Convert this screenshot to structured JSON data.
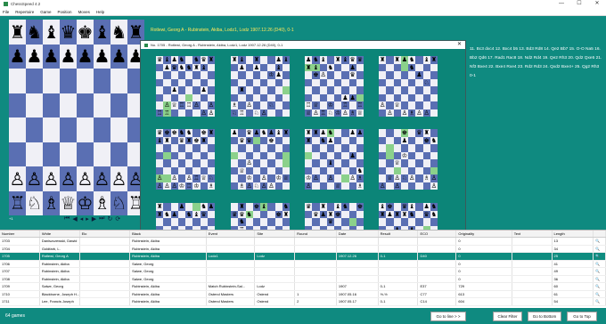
{
  "window": {
    "title": "ChessSpeed 4.2",
    "controls": [
      "—",
      "☐",
      "✕"
    ]
  },
  "menu": [
    "File",
    "Repertoire",
    "Game",
    "Position",
    "Moves",
    "Help"
  ],
  "main_board": {
    "ranks": [
      [
        "♜",
        "♞",
        "♝",
        "♛",
        "♚",
        "♝",
        "♞",
        "♜"
      ],
      [
        "♟",
        "♟",
        "♟",
        "♟",
        "♟",
        "♟",
        "♟",
        "♟"
      ],
      [
        "",
        "",
        "",
        "",
        "",
        "",
        "",
        ""
      ],
      [
        "",
        "",
        "",
        "",
        "",
        "",
        "",
        ""
      ],
      [
        "",
        "",
        "",
        "",
        "",
        "",
        "",
        ""
      ],
      [
        "",
        "",
        "",
        "",
        "",
        "",
        "",
        ""
      ],
      [
        "♙",
        "♙",
        "♙",
        "♙",
        "♙",
        "♙",
        "♙",
        "♙"
      ],
      [
        "♖",
        "♘",
        "♗",
        "♕",
        "♔",
        "♗",
        "♘",
        "♖"
      ]
    ],
    "coordinate_label": "+1",
    "nav_icons": [
      "first-move-icon",
      "prev-move-icon",
      "prev-step-icon",
      "next-step-icon",
      "next-move-icon",
      "last-move-icon",
      "flip-icon"
    ],
    "nav_glyphs": [
      "⏮",
      "◀",
      "◂",
      "▸",
      "▶",
      "⏭",
      "↻",
      "⟳"
    ]
  },
  "game_header": "Rotlewi, Georg A - Rubinstein, Akiba, Lodz1, Lodz 1907.12.26 (D40), 0-1",
  "movetext": "11. Bc3 dxc4 12. Bxc4 b5 13. Bd3 Rd8 14. Qe2 Bb7 15. O-O Na5 16. Bb2 Qd6 17. Rad1 Rac8 18. Nd2 Rd4 19. Qe2 Rh3 20. Qd2 Qxe5 21. Nf3 Bxe4 22. Bxe4 Rxe4 23. Rd2 Rd3 24. Qxd2 Bxe4+ 25. Qg2 Rh3 0-1",
  "popup": {
    "title": "No. 1705 - Rotlewi, Georg A - Rubinstein, Akiba, Lodz1, Lodz 1907.12.26 (D40), 0-1",
    "close_glyph": "✕",
    "side_controls": [
      "○",
      "◆",
      "⮕"
    ]
  },
  "table": {
    "columns": [
      "Number",
      "White",
      "Elo",
      "Black",
      "Elo",
      "Event",
      "Site",
      "Round",
      "Date",
      "Result",
      "ECO",
      "Originality",
      "Text",
      "Length",
      ""
    ],
    "rows": [
      [
        "1703",
        "Daniszczewski, Dawid",
        "",
        "Rubinstein, Akiba",
        "",
        "",
        "",
        "",
        "",
        "",
        "",
        "0",
        "",
        "13"
      ],
      [
        "1704",
        "Goldfarb, L.",
        "",
        "Rubinstein, Akiba",
        "",
        "",
        "",
        "",
        "",
        "",
        "",
        "0",
        "",
        "34"
      ],
      [
        "1705",
        "Rotlewi, Georg A",
        "",
        "Rubinstein, Akiba",
        "",
        "Lodz1",
        "Lodz",
        "",
        "1907.12.26",
        "0-1",
        "D40",
        "0",
        "",
        "25"
      ],
      [
        "1706",
        "Rubinstein, Akiba",
        "",
        "Salwe, Georg",
        "",
        "",
        "",
        "",
        "",
        "",
        "",
        "0",
        "",
        "41"
      ],
      [
        "1707",
        "Rubinstein, Akiba",
        "",
        "Salwe, Georg",
        "",
        "",
        "",
        "",
        "",
        "",
        "",
        "0",
        "",
        "49"
      ],
      [
        "1708",
        "Rubinstein, Akiba",
        "",
        "Salwe, Georg",
        "",
        "",
        "",
        "",
        "",
        "",
        "",
        "0",
        "",
        "36"
      ],
      [
        "1709",
        "Salwe, Georg",
        "",
        "Rubinstein, Akiba",
        "",
        "Match Rubinstein-Sal...",
        "Lodz",
        "",
        "1907",
        "0-1",
        "E37",
        "729",
        "",
        "60"
      ],
      [
        "1710",
        "Blackburne, Joseph H...",
        "",
        "Rubinstein, Akiba",
        "",
        "Ostend Masters",
        "Ostend",
        "1",
        "1907.05.16",
        "½-½",
        "C77",
        "613",
        "",
        "61"
      ],
      [
        "1711",
        "Lee, Francis Joseph",
        "",
        "Rubinstein, Akiba",
        "",
        "Ostend Masters",
        "Ostend",
        "2",
        "1907.05.17",
        "0-1",
        "C14",
        "604",
        "",
        "54"
      ]
    ],
    "search_icon": "search-icon"
  },
  "status": {
    "games": "64 games",
    "buttons": [
      "Go to line > >",
      "Clear Filter",
      "Go to Bottom",
      "Go to Top"
    ]
  },
  "colors": {
    "background": "#0f8a80",
    "board_dark": "#5a6fb3",
    "board_light": "#f0f0f6",
    "header_text": "#ffe95a",
    "selection": "#0e8c7f"
  }
}
